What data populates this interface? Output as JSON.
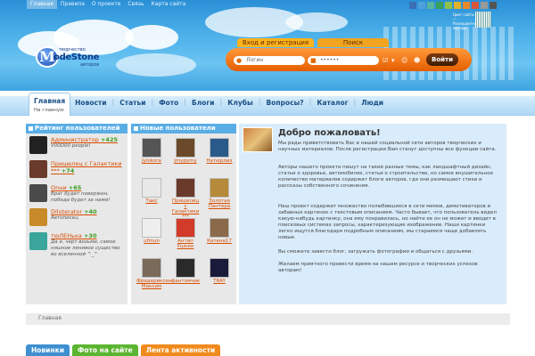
{
  "topnav": [
    "Главная",
    "Правила",
    "О проекте",
    "Связь",
    "Карта сайта"
  ],
  "palette": [
    "#3b6fb6",
    "#4fa0d9",
    "#58b4a0",
    "#3aa05a",
    "#8fc34a",
    "#e0b12a",
    "#e88a2a",
    "#d8553a",
    "#9a9a9a",
    "#555555"
  ],
  "city_info": "Цвет сайта — Разноцветные авторы",
  "logo": {
    "letter": "M",
    "top": "творчество",
    "name": "odeStone",
    "bottom": "авторов"
  },
  "auth": {
    "tab_login": "Вход и регистрация",
    "tab_search": "Поиск",
    "login_placeholder": "Логин",
    "password_mask": "••••••",
    "enter_button": "Войти"
  },
  "mainnav": {
    "home": "Главная",
    "home_sub": "На главную",
    "items": [
      "Новости",
      "Статьи",
      "Фото",
      "Блоги",
      "Клубы",
      "Вопросы?",
      "Каталог",
      "Люди"
    ]
  },
  "rating": {
    "title": "Рейтинг пользователей",
    "items": [
      {
        "name": "Администратор",
        "score": "+425",
        "quote": "V00D00 people!",
        "color": "#222"
      },
      {
        "name": "Пришелец с Галактики ***",
        "score": "+74",
        "quote": "",
        "color": "#6a3a2a"
      },
      {
        "name": "Onни",
        "score": "+65",
        "quote": "Враг будет повержен, победа будет за нами!",
        "color": "#4a4a4a"
      },
      {
        "name": "Diloterator",
        "score": "+40",
        "quote": "Автописец",
        "color": "#c98a2a"
      },
      {
        "name": "тюЛЕНька",
        "score": "+30",
        "quote": "Да я, черт возьми, самое няшное ленивое существо во вселенной ^_^",
        "color": "#3aa59a"
      }
    ]
  },
  "newusers": {
    "title": "Новые пользователи",
    "items": [
      {
        "name": "Jylokora",
        "color": "#555"
      },
      {
        "name": "jmypymy",
        "color": "#6a4a2a"
      },
      {
        "name": "Натюрлих",
        "color": "#2a5a8a"
      },
      {
        "name": "Таис",
        "color": "#e8e8e8"
      },
      {
        "name": "Пришелец с Галактики ***",
        "color": "#6a3a2a"
      },
      {
        "name": "Золотая Пантера",
        "color": "#b58a3a"
      },
      {
        "name": "ufmun",
        "color": "#eeeeee"
      },
      {
        "name": "Антип Ушкин",
        "color": "#d23a2a"
      },
      {
        "name": "Катена17",
        "color": "#8a6a4a"
      },
      {
        "name": "Фридериксен Максим",
        "color": "#7a6a5a"
      },
      {
        "name": "фантомчик",
        "color": "#2a2a2a"
      },
      {
        "name": "TRAY",
        "color": "#1a1a3a"
      }
    ]
  },
  "welcome": {
    "title": "Добро пожаловать!",
    "paragraphs": [
      "Мы рады приветствовать Вас в нашей социальной сети авторов творческих и научных материалов. После регистрации Вам станут доступны все функции сайта.",
      "Авторы нашего проекта пишут на такие разные темы, как ландшафтный дизайн, статьи о здоровье, автомобилях, статьи о строительстве, но самое внушительное количество материалов содержат блоги авторов, где они размещают стихи и рассказы собственного сочинения.",
      "Наш проект содержит множество полюбившихся в сети мемов, демотиваторов и забавных картинок с текстовым описанием. Часто бывает, что пользователь видел какую-нибудь картинку, она ему понравилась, но найти ее он не может и вводит в поисковых системах запросы, характеризующие изображение. Наши картинки легко ищутся благодаря подробным описаниям, мы стараемся чаще добавлять новые.",
      "Вы сможете завести блог, загружать фотографии и общаться с друзьями.",
      "Желаем приятного провести время на нашем ресурсе и творческих успехов авторам!"
    ]
  },
  "breadcrumb": "Главная",
  "bottomtabs": [
    "Новинки",
    "Фото на сайте",
    "Лента активности"
  ]
}
